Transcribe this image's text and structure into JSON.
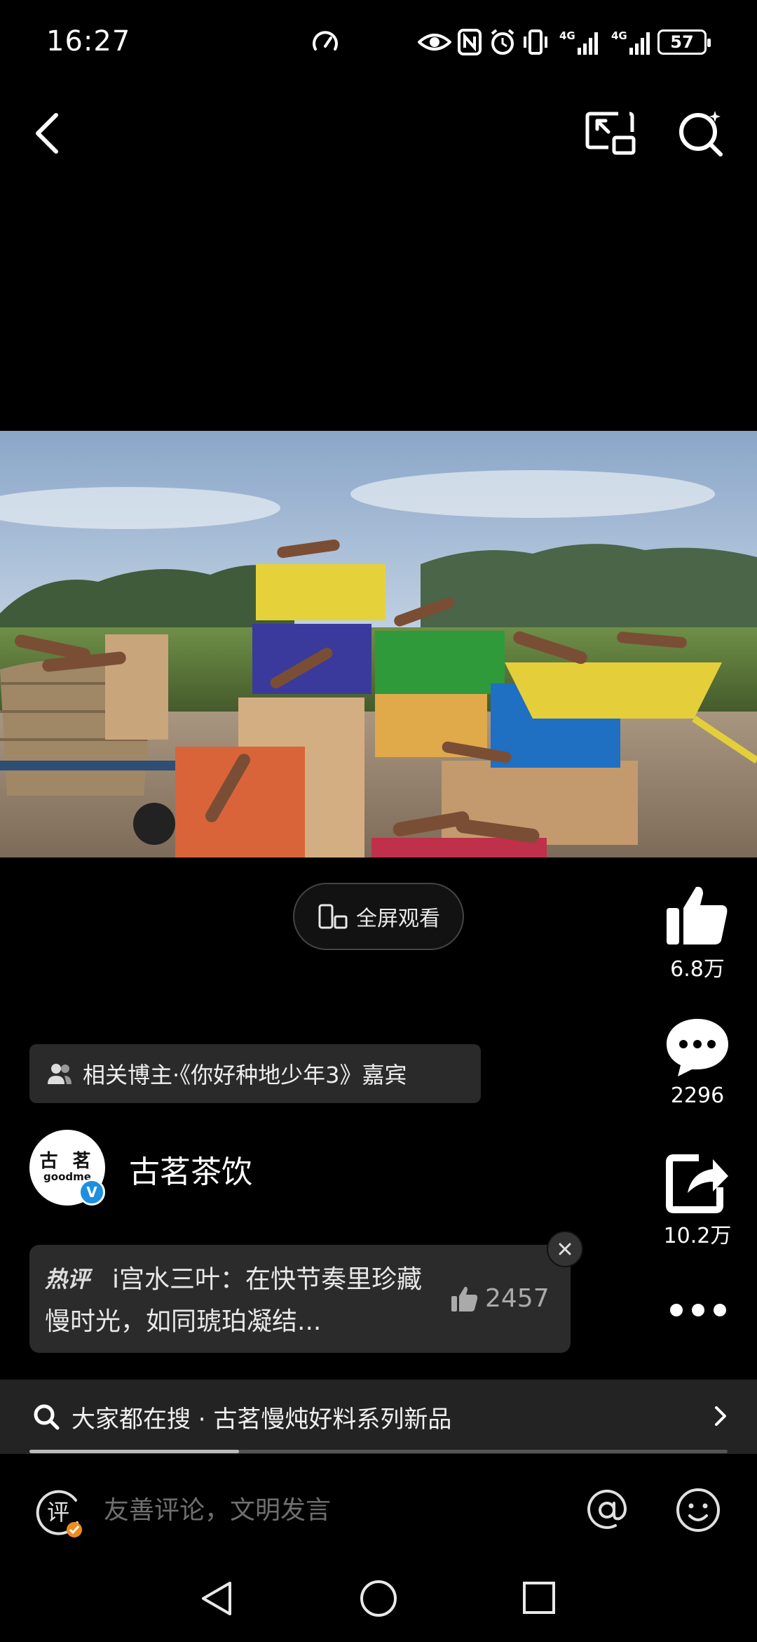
{
  "status_bar": {
    "time": "16:27",
    "battery": "57",
    "icons": [
      "speed-icon",
      "eye-icon",
      "nfc-icon",
      "alarm-icon",
      "vibrate-icon",
      "signal-4g-icon",
      "signal-4g-icon"
    ]
  },
  "related_tag": {
    "text": "相关博主·《你好种地少年3》嘉宾",
    "icon": "users-icon"
  },
  "author": {
    "name": "古茗茶饮",
    "avatar_cn": "古 茗",
    "avatar_en": "goodme",
    "verified": "V"
  },
  "fullscreen_button": {
    "label": "全屏观看"
  },
  "actions": {
    "like_count": "6.8万",
    "comment_count": "2296",
    "share_count": "10.2万"
  },
  "hot_comment": {
    "badge": "热评",
    "text": "i宫水三叶：在快节奏里珍藏慢时光，如同琥珀凝结...",
    "like_count": "2457"
  },
  "search_bar": {
    "text": "大家都在搜 · 古茗慢炖好料系列新品"
  },
  "progress": {
    "fraction": 0.3
  },
  "comment_input": {
    "icon_text": "评",
    "placeholder": "友善评论，文明发言"
  },
  "colors": {
    "background": "#000000",
    "card": "#2b2b2b",
    "verified_blue": "#1e8fe0",
    "comment_badge_orange": "#f08c1e",
    "hot_red": "#e03b3b"
  }
}
